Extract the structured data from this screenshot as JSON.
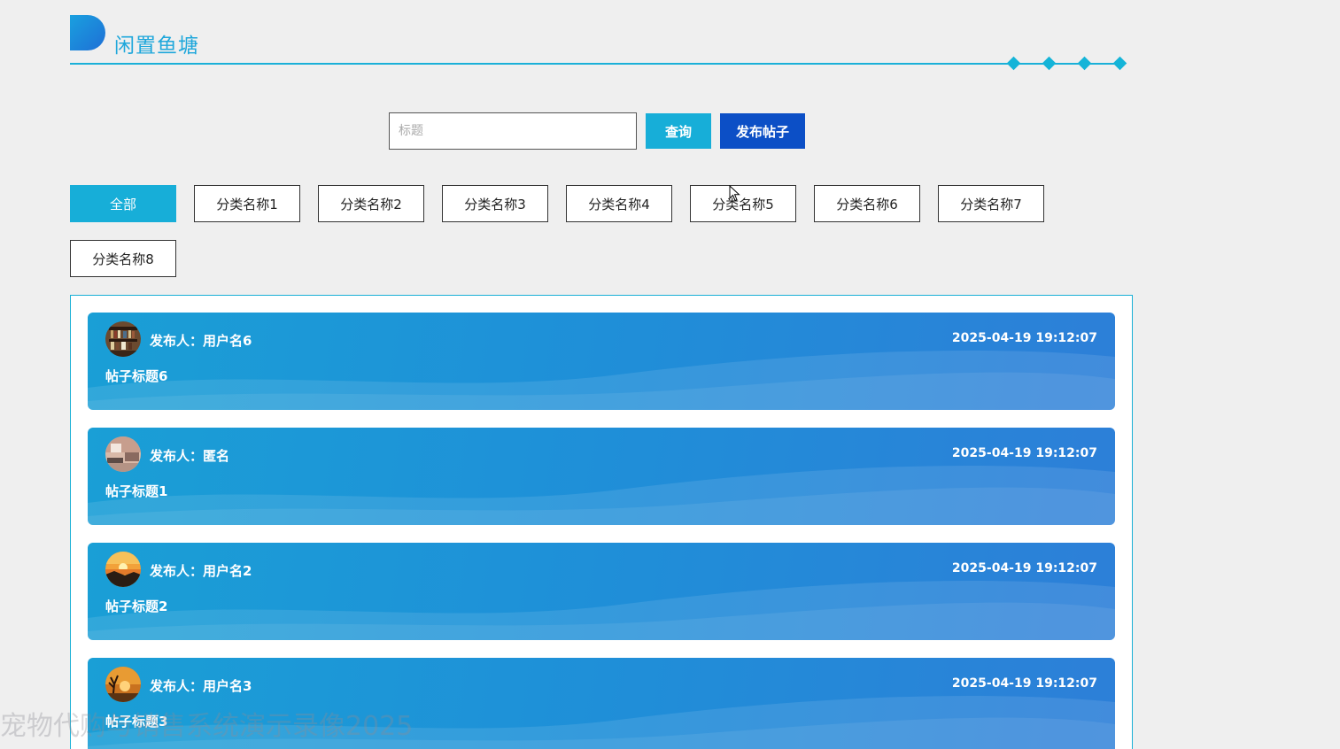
{
  "header": {
    "title": "闲置鱼塘",
    "accent_color": "#1ea7db"
  },
  "search": {
    "placeholder": "标题",
    "value": "",
    "query_label": "查询",
    "post_label": "发布帖子"
  },
  "categories": [
    {
      "label": "全部",
      "active": true
    },
    {
      "label": "分类名称1",
      "active": false
    },
    {
      "label": "分类名称2",
      "active": false
    },
    {
      "label": "分类名称3",
      "active": false
    },
    {
      "label": "分类名称4",
      "active": false
    },
    {
      "label": "分类名称5",
      "active": false
    },
    {
      "label": "分类名称6",
      "active": false
    },
    {
      "label": "分类名称7",
      "active": false
    },
    {
      "label": "分类名称8",
      "active": false
    }
  ],
  "posts": [
    {
      "author": "发布人：用户名6",
      "time": "2025-04-19 19:12:07",
      "title": "帖子标题6",
      "avatar": "bookshelf-avatar"
    },
    {
      "author": "发布人：匿名",
      "time": "2025-04-19 19:12:07",
      "title": "帖子标题1",
      "avatar": "room-avatar"
    },
    {
      "author": "发布人：用户名2",
      "time": "2025-04-19 19:12:07",
      "title": "帖子标题2",
      "avatar": "sunset-avatar"
    },
    {
      "author": "发布人：用户名3",
      "time": "2025-04-19 19:12:07",
      "title": "帖子标题3",
      "avatar": "tree-sunset-avatar"
    }
  ],
  "watermark": "宠物代购与销售系统演示录像2025"
}
